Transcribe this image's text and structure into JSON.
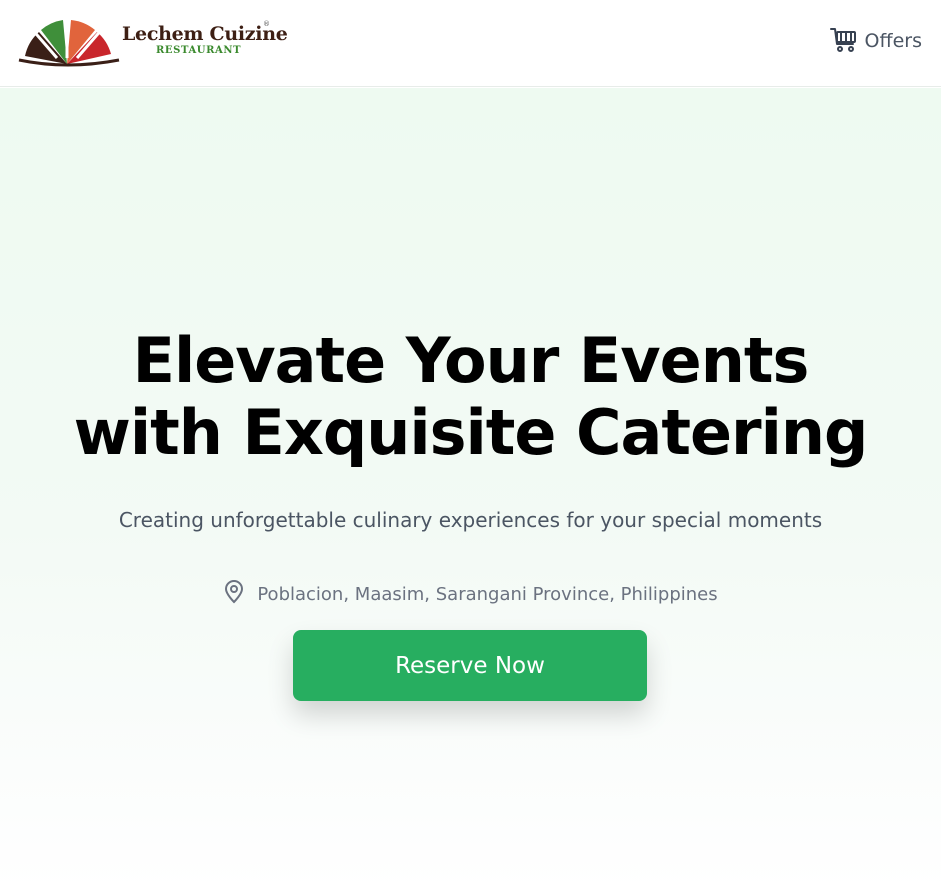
{
  "header": {
    "brand_name": "Lechem Cuizine",
    "brand_registered": "®",
    "brand_subtitle": "RESTAURANT",
    "offers_label": "Offers",
    "offers_icon": "shopping-cart-icon"
  },
  "hero": {
    "title_line1": "Elevate Your Events",
    "title_line2": "with Exquisite Catering",
    "subtitle": "Creating unforgettable culinary experiences for your special moments",
    "location_icon": "map-pin-icon",
    "location": "Poblacion, Maasim, Sarangani Province, Philippines",
    "cta_label": "Reserve Now"
  },
  "colors": {
    "accent_green": "#27ae60",
    "hero_background": "#eefaf1",
    "muted_text": "#4b5563",
    "brand_brown": "#3d1f14",
    "brand_green": "#3b8a2e"
  }
}
